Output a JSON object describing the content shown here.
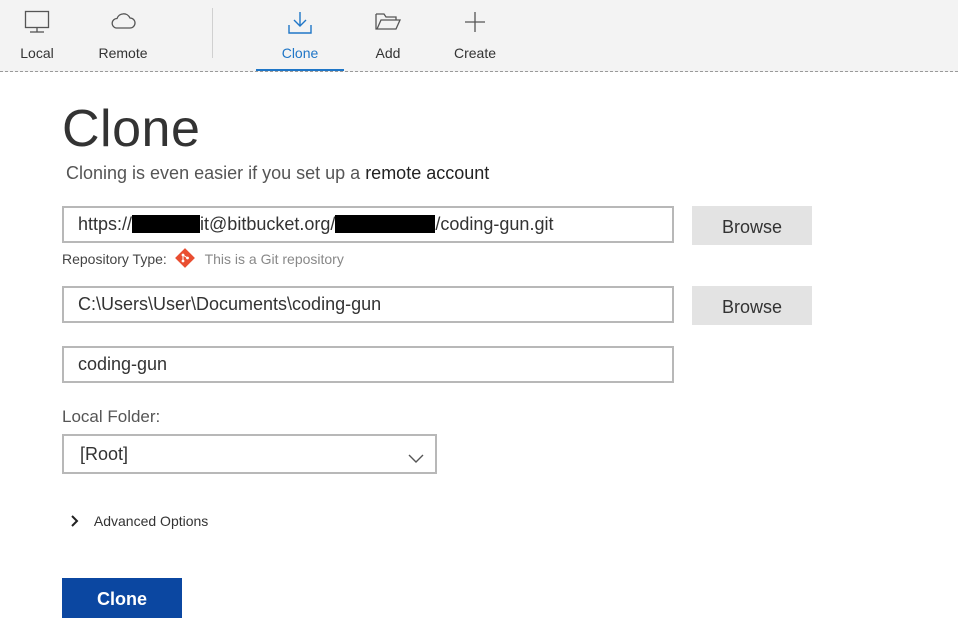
{
  "toolbar": {
    "tabs": [
      {
        "label": "Local",
        "icon": "monitor-icon"
      },
      {
        "label": "Remote",
        "icon": "cloud-icon"
      },
      {
        "label": "Clone",
        "icon": "download-icon",
        "active": true
      },
      {
        "label": "Add",
        "icon": "folder-open-icon"
      },
      {
        "label": "Create",
        "icon": "plus-icon"
      }
    ],
    "active_color": "#1f76c7"
  },
  "page": {
    "title": "Clone",
    "subtitle_prefix": "Cloning is even easier if you set up a",
    "subtitle_link": "remote account"
  },
  "form": {
    "source_url_parts": [
      "https://",
      "it@bitbucket.org/",
      "/coding-gun.git"
    ],
    "browse_label": "Browse",
    "repo_type_label": "Repository Type:",
    "repo_type_value": "This is a Git repository",
    "destination_path": "C:\\Users\\User\\Documents\\coding-gun",
    "name": "coding-gun",
    "local_folder_label": "Local Folder:",
    "local_folder_value": "[Root]",
    "advanced_label": "Advanced Options",
    "clone_button": "Clone",
    "clone_button_color": "#0b47a1"
  }
}
